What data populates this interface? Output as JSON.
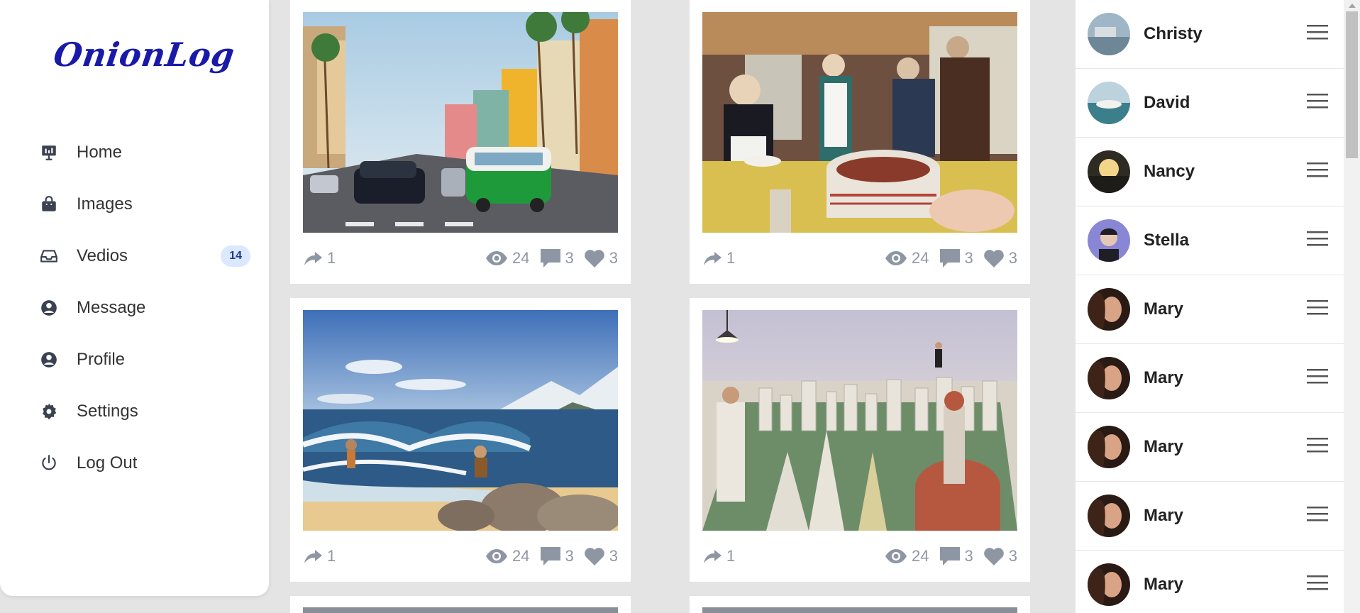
{
  "app": {
    "logo": "OnionLog"
  },
  "nav": {
    "items": [
      {
        "label": "Home",
        "icon": "home-chart-icon"
      },
      {
        "label": "Images",
        "icon": "shopping-bag-icon"
      },
      {
        "label": "Vedios",
        "icon": "inbox-icon",
        "badge": "14"
      },
      {
        "label": "Message",
        "icon": "user-circle-icon"
      },
      {
        "label": "Profile",
        "icon": "user-circle-icon"
      },
      {
        "label": "Settings",
        "icon": "gear-icon"
      },
      {
        "label": "Log Out",
        "icon": "power-icon"
      }
    ]
  },
  "feed": {
    "posts": [
      {
        "scene": "street",
        "shares": "1",
        "views": "24",
        "comments": "3",
        "likes": "3"
      },
      {
        "scene": "diner",
        "shares": "1",
        "views": "24",
        "comments": "3",
        "likes": "3"
      },
      {
        "scene": "beach",
        "shares": "1",
        "views": "24",
        "comments": "3",
        "likes": "3"
      },
      {
        "scene": "city",
        "shares": "1",
        "views": "24",
        "comments": "3",
        "likes": "3"
      }
    ]
  },
  "users": [
    {
      "name": "Christy"
    },
    {
      "name": "David"
    },
    {
      "name": "Nancy"
    },
    {
      "name": "Stella"
    },
    {
      "name": "Mary"
    },
    {
      "name": "Mary"
    },
    {
      "name": "Mary"
    },
    {
      "name": "Mary"
    },
    {
      "name": "Mary"
    }
  ],
  "colors": {
    "accent": "#1a1aa8",
    "muted": "#8f96a3",
    "badge_bg": "#dbe8ff"
  }
}
